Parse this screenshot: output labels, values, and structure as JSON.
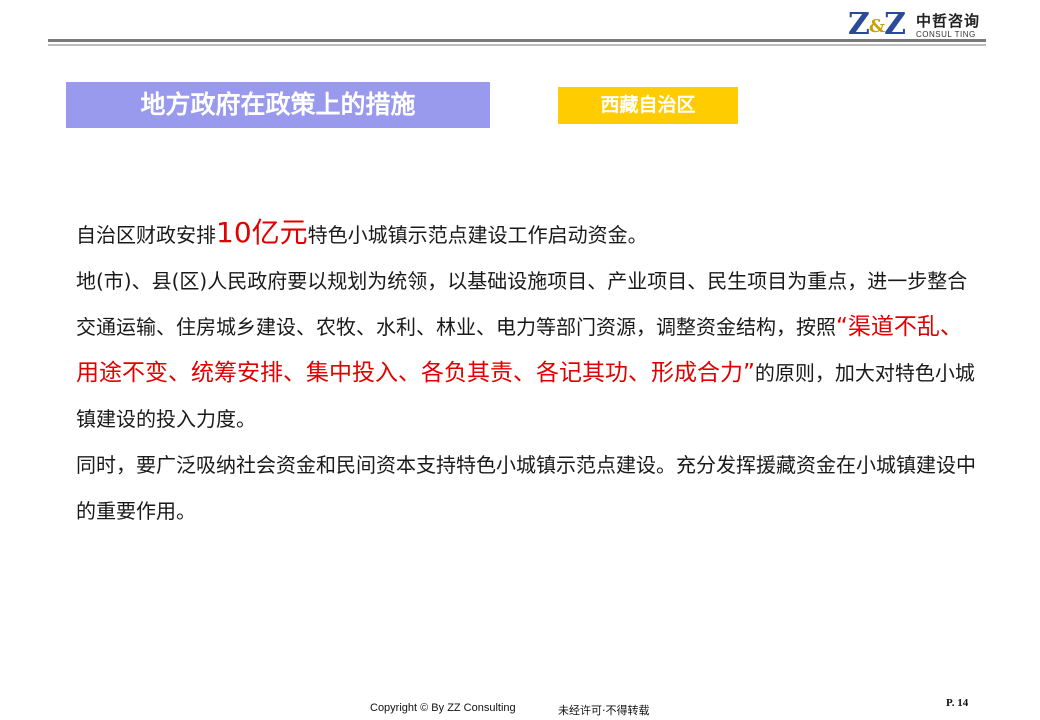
{
  "header": {
    "logo_mark": "Z&Z",
    "logo_cn": "中哲咨询",
    "logo_en": "CONSUL TING"
  },
  "slide": {
    "title": "地方政府在政策上的措施",
    "region": "西藏自治区"
  },
  "body": {
    "p1_before": "自治区财政安排",
    "p1_highlight": "10亿元",
    "p1_after": "特色小城镇示范点建设工作启动资金。",
    "p2_before": "地(市)、县(区)人民政府要以规划为统领，以基础设施项目、产业项目、民生项目为重点，进一步整合交通运输、住房城乡建设、农牧、水利、林业、电力等部门资源，调整资金结构，按照",
    "p2_highlight": "“渠道不乱、用途不变、统筹安排、集中投入、各负其责、各记其功、形成合力”",
    "p2_after": "的原则，加大对特色小城镇建设的投入力度。",
    "p3": "同时，要广泛吸纳社会资金和民间资本支持特色小城镇示范点建设。充分发挥援藏资金在小城镇建设中的重要作用。"
  },
  "footer": {
    "copyright": "Copyright © By  ZZ Consulting",
    "note": "未经许可·不得转载",
    "page": "P. 14"
  }
}
